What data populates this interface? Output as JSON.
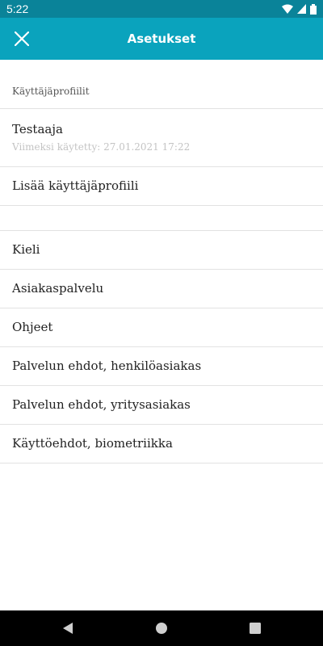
{
  "status_bar": {
    "time": "5:22",
    "icons": [
      "wifi-icon",
      "signal-icon",
      "battery-icon"
    ]
  },
  "app_bar": {
    "title": "Asetukset",
    "close_icon": "close-icon",
    "background": "#0aa3bd"
  },
  "profiles_section": {
    "header": "Käyttäjäprofiilit",
    "profile": {
      "name": "Testaaja",
      "last_used": "Viimeksi käytetty: 27.01.2021 17:22"
    },
    "add_profile": "Lisää käyttäjäprofiili"
  },
  "menu_items": [
    "Kieli",
    "Asiakaspalvelu",
    "Ohjeet",
    "Palvelun ehdot, henkilöasiakas",
    "Palvelun ehdot, yritysasiakas",
    "Käyttöehdot, biometriikka"
  ],
  "nav_bar": {
    "icons": [
      "back-icon",
      "home-icon",
      "recents-icon"
    ]
  }
}
